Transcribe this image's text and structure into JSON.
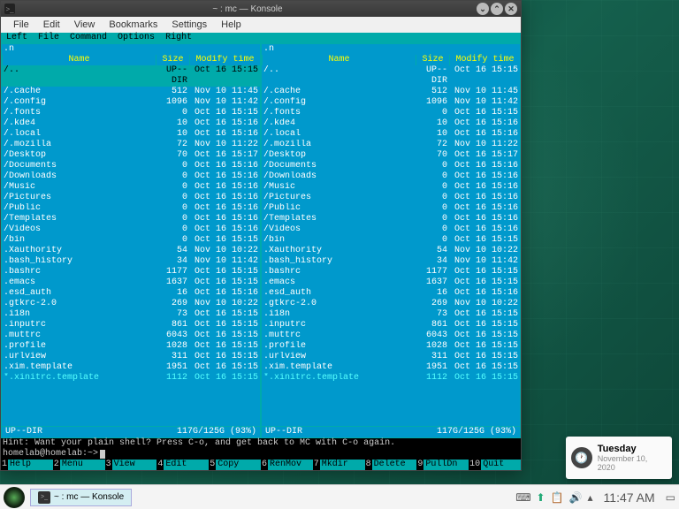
{
  "window": {
    "title": "~ : mc — Konsole",
    "menubar": [
      "File",
      "Edit",
      "View",
      "Bookmarks",
      "Settings",
      "Help"
    ]
  },
  "mc": {
    "topmenu": [
      "Left",
      "File",
      "Command",
      "Options",
      "Right"
    ],
    "headers": {
      "name": "Name",
      "size": "Size",
      "mtime": "Modify time",
      "nav": ".n"
    },
    "files": [
      {
        "name": "/..",
        "size": "UP--DIR",
        "date": "Oct 16 15:15",
        "sel": true
      },
      {
        "name": "/.cache",
        "size": "512",
        "date": "Nov 10 11:45"
      },
      {
        "name": "/.config",
        "size": "1096",
        "date": "Nov 10 11:42"
      },
      {
        "name": "/.fonts",
        "size": "0",
        "date": "Oct 16 15:15"
      },
      {
        "name": "/.kde4",
        "size": "10",
        "date": "Oct 16 15:16"
      },
      {
        "name": "/.local",
        "size": "10",
        "date": "Oct 16 15:16"
      },
      {
        "name": "/.mozilla",
        "size": "72",
        "date": "Nov 10 11:22"
      },
      {
        "name": "/Desktop",
        "size": "70",
        "date": "Oct 16 15:17"
      },
      {
        "name": "/Documents",
        "size": "0",
        "date": "Oct 16 15:16"
      },
      {
        "name": "/Downloads",
        "size": "0",
        "date": "Oct 16 15:16"
      },
      {
        "name": "/Music",
        "size": "0",
        "date": "Oct 16 15:16"
      },
      {
        "name": "/Pictures",
        "size": "0",
        "date": "Oct 16 15:16"
      },
      {
        "name": "/Public",
        "size": "0",
        "date": "Oct 16 15:16"
      },
      {
        "name": "/Templates",
        "size": "0",
        "date": "Oct 16 15:16"
      },
      {
        "name": "/Videos",
        "size": "0",
        "date": "Oct 16 15:16"
      },
      {
        "name": "/bin",
        "size": "0",
        "date": "Oct 16 15:15"
      },
      {
        "name": " .Xauthority",
        "size": "54",
        "date": "Nov 10 10:22"
      },
      {
        "name": " .bash_history",
        "size": "34",
        "date": "Nov 10 11:42"
      },
      {
        "name": " .bashrc",
        "size": "1177",
        "date": "Oct 16 15:15"
      },
      {
        "name": " .emacs",
        "size": "1637",
        "date": "Oct 16 15:15"
      },
      {
        "name": " .esd_auth",
        "size": "16",
        "date": "Oct 16 15:16"
      },
      {
        "name": " .gtkrc-2.0",
        "size": "269",
        "date": "Nov 10 10:22"
      },
      {
        "name": " .i18n",
        "size": "73",
        "date": "Oct 16 15:15"
      },
      {
        "name": " .inputrc",
        "size": "861",
        "date": "Oct 16 15:15"
      },
      {
        "name": " .muttrc",
        "size": "6043",
        "date": "Oct 16 15:15"
      },
      {
        "name": " .profile",
        "size": "1028",
        "date": "Oct 16 15:15"
      },
      {
        "name": " .urlview",
        "size": "311",
        "date": "Oct 16 15:15"
      },
      {
        "name": " .xim.template",
        "size": "1951",
        "date": "Oct 16 15:15"
      },
      {
        "name": "*.xinitrc.template",
        "size": "1112",
        "date": "Oct 16 15:15",
        "hl": true
      }
    ],
    "status_left": "UP--DIR",
    "status_right": "117G/125G (93%)",
    "hint": "Hint: Want your plain shell? Press C-o, and get back to MC with C-o again.",
    "prompt": "homelab@homelab:~> ",
    "fkeys": [
      {
        "n": "1",
        "l": "Help"
      },
      {
        "n": "2",
        "l": "Menu"
      },
      {
        "n": "3",
        "l": "View"
      },
      {
        "n": "4",
        "l": "Edit"
      },
      {
        "n": "5",
        "l": "Copy"
      },
      {
        "n": "6",
        "l": "RenMov"
      },
      {
        "n": "7",
        "l": "Mkdir"
      },
      {
        "n": "8",
        "l": "Delete"
      },
      {
        "n": "9",
        "l": "PullDn"
      },
      {
        "n": "10",
        "l": "Quit"
      }
    ]
  },
  "notification": {
    "day": "Tuesday",
    "date": "November 10, 2020"
  },
  "taskbar": {
    "item": "~ : mc — Konsole",
    "clock": "11:47 AM"
  }
}
